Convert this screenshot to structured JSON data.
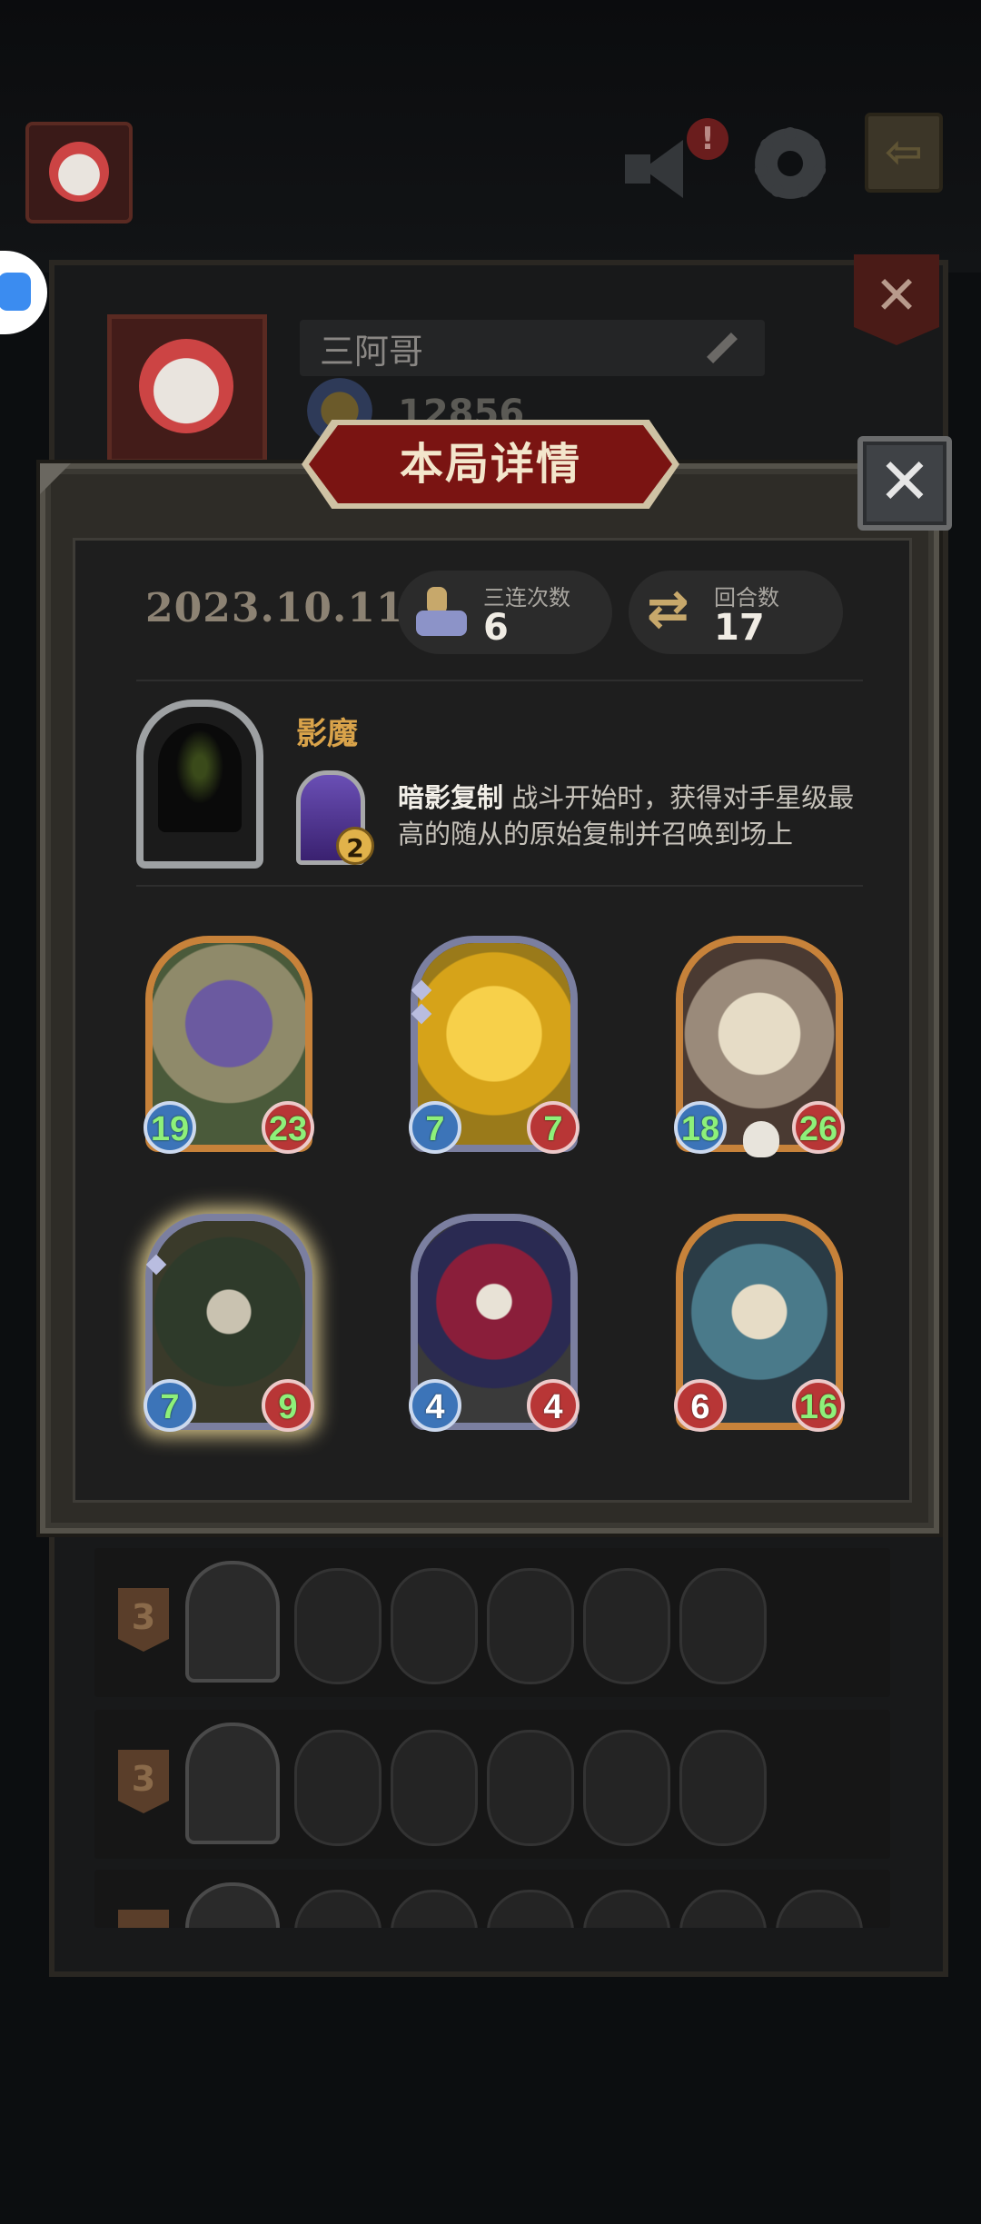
{
  "profile": {
    "name": "三阿哥",
    "score": "12856",
    "notify_badge": "!"
  },
  "modal": {
    "title": "本局详情",
    "close_symbol": "✕"
  },
  "summary": {
    "date": "2023.10.11",
    "triples_label": "三连次数",
    "triples_value": "6",
    "rounds_label": "回合数",
    "rounds_value": "17"
  },
  "hero": {
    "name": "影魔",
    "skill_level": "2",
    "skill_name": "暗影复制",
    "skill_text": " 战斗开始时，获得对手星级最高的随从的原始复制并召唤到场上"
  },
  "minions": [
    {
      "attack": "19",
      "health": "23",
      "frame": "gold",
      "stat_color": "green"
    },
    {
      "attack": "7",
      "health": "7",
      "frame": "silver",
      "stat_color": "green"
    },
    {
      "attack": "18",
      "health": "26",
      "frame": "gold",
      "stat_color": "green"
    },
    {
      "attack": "7",
      "health": "9",
      "frame": "glow",
      "stat_color": "green"
    },
    {
      "attack": "4",
      "health": "4",
      "frame": "silver",
      "stat_color": "white"
    },
    {
      "attack": "6",
      "health": "16",
      "frame": "gold",
      "stat_color": "mixed"
    }
  ],
  "records": [
    {
      "rank": "3"
    },
    {
      "rank": "3"
    },
    {
      "rank": ""
    }
  ]
}
